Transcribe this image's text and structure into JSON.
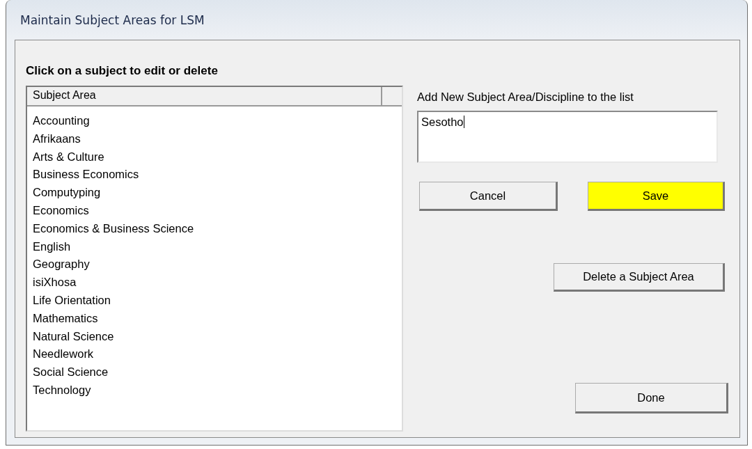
{
  "window": {
    "title": "Maintain Subject Areas for LSM"
  },
  "list_heading": "Click on a subject to edit or delete",
  "subject_list": {
    "column_header": "Subject Area",
    "items": [
      "Accounting",
      "Afrikaans",
      "Arts & Culture",
      "Business Economics",
      "Computyping",
      "Economics",
      "Economics & Business Science",
      "English",
      "Geography",
      "isiXhosa",
      "Life Orientation",
      "Mathematics",
      "Natural Science",
      "Needlework",
      "Social Science",
      "Technology"
    ]
  },
  "new_subject": {
    "label": "Add New Subject Area/Discipline to the list",
    "value": "Sesotho",
    "focused": true
  },
  "cancel_button": {
    "label": "Cancel"
  },
  "save_button": {
    "label": "Save",
    "color": "#ffff00"
  },
  "delete_button": {
    "label": "Delete a Subject Area"
  },
  "done_button": {
    "label": "Done"
  }
}
